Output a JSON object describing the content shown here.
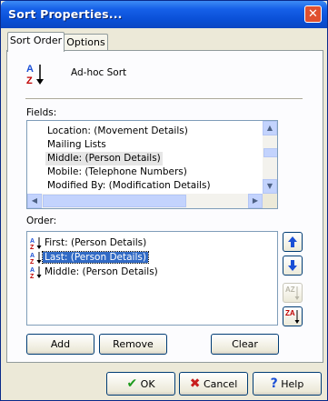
{
  "window": {
    "title": "Sort Properties..."
  },
  "tabs": [
    {
      "label": "Sort Order"
    },
    {
      "label": "Options"
    }
  ],
  "header": {
    "icon": "sort-az-icon",
    "label": "Ad-hoc Sort"
  },
  "fields": {
    "label": "Fields:",
    "items": [
      "Location: (Movement Details)",
      "Mailing Lists",
      "Middle: (Person Details)",
      "Mobile: (Telephone Numbers)",
      "Modified By: (Modification Details)"
    ],
    "selected": "Middle: (Person Details)"
  },
  "order": {
    "label": "Order:",
    "items": [
      "First: (Person Details)",
      "Last: (Person Details)",
      "Middle: (Person Details)"
    ],
    "selected": "Last: (Person Details)"
  },
  "buttons": {
    "add": "Add",
    "remove": "Remove",
    "clear": "Clear",
    "ok": "OK",
    "cancel": "Cancel",
    "help": "Help"
  },
  "side_buttons": {
    "sort_ascending_icon_text": "AZ",
    "sort_descending_icon_text": "ZA"
  },
  "colors": {
    "title_bar": "#0a4fd6",
    "selection": "#316ac5",
    "accent_blue": "#1a4fd6"
  }
}
